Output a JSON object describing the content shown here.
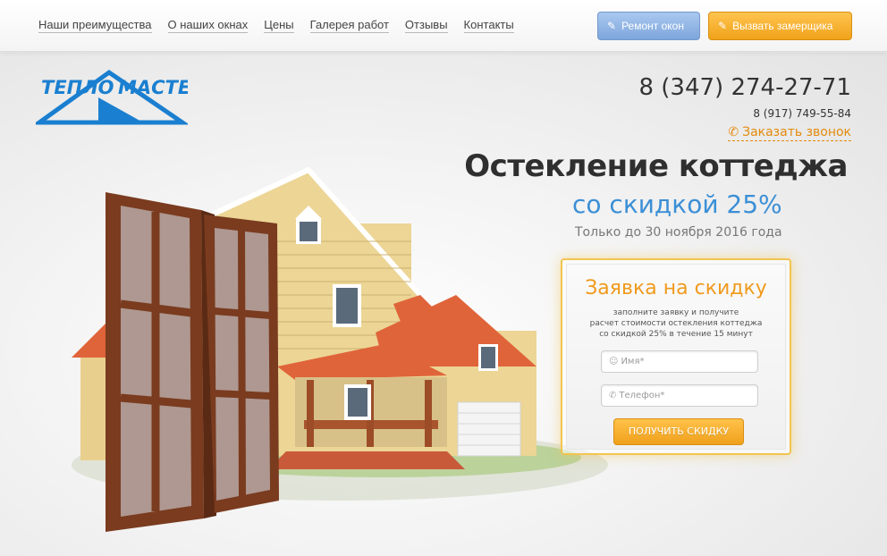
{
  "nav": {
    "items": [
      "Наши преимущества",
      "О наших окнах",
      "Цены",
      "Галерея работ",
      "Отзывы",
      "Контакты"
    ],
    "repair_button": "Ремонт окон",
    "measure_button": "Вызвать замерщика"
  },
  "logo": {
    "text_left": "ТЕПЛО",
    "text_right": "МАСТЕР"
  },
  "contacts": {
    "phone_main": "8 (347) 274-27-71",
    "phone_sub": "8 (917) 749-55-84",
    "callback": "Заказать звонок"
  },
  "hero": {
    "headline": "Остекление коттеджа",
    "subheadline": "со скидкой 25%",
    "deadline": "Только до 30 ноября 2016 года"
  },
  "form": {
    "title": "Заявка на скидку",
    "desc_line1": "заполните заявку и получите",
    "desc_line2": "расчет стоимости остекления коттеджа",
    "desc_line3": "со скидкой 25% в течение 15 минут",
    "name_placeholder": "Имя*",
    "phone_placeholder": "Телефон*",
    "submit_label": "ПОЛУЧИТЬ СКИДКУ"
  },
  "colors": {
    "accent_orange": "#f0a01c",
    "accent_blue": "#3b8fd6",
    "logo_blue": "#1a7fd0"
  }
}
